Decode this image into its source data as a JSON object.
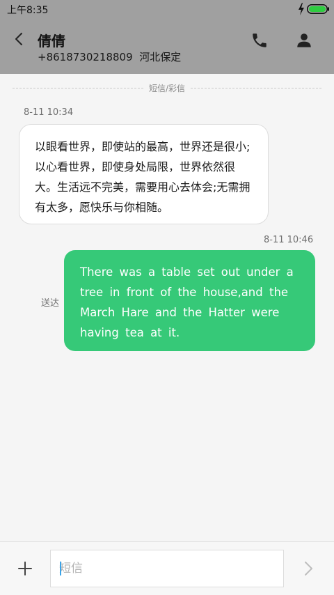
{
  "status_bar": {
    "time": "上午8:35",
    "icons": [
      "charging-bolt-icon",
      "battery-full-icon"
    ],
    "battery_color": "#2ecc40"
  },
  "header": {
    "contact_name": "倩倩",
    "contact_number": "+8618730218809",
    "contact_location": "河北保定",
    "icons": [
      "back-arrow-icon",
      "phone-icon",
      "contact-person-icon"
    ],
    "background_color": "#a0a0a0"
  },
  "divider": {
    "label": "短信/彩信"
  },
  "messages": [
    {
      "direction": "incoming",
      "timestamp": "8-11  10:34",
      "text": "以眼看世界，即使站的最高，世界还是很小;以心看世界，即使身处局限，世界依然很大。生活远不完美，需要用心去体会;无需拥有太多，愿快乐与你相随。",
      "bubble_color": "#ffffff"
    },
    {
      "direction": "outgoing",
      "timestamp": "8-11  10:46",
      "status": "送达",
      "text": "There was a table set out under a tree in front of the house,and the March Hare and the Hatter were having tea at it.",
      "bubble_color": "#36c978"
    }
  ],
  "composer": {
    "placeholder": "短信",
    "value": "",
    "icons": [
      "plus-icon",
      "send-chevron-icon"
    ]
  }
}
